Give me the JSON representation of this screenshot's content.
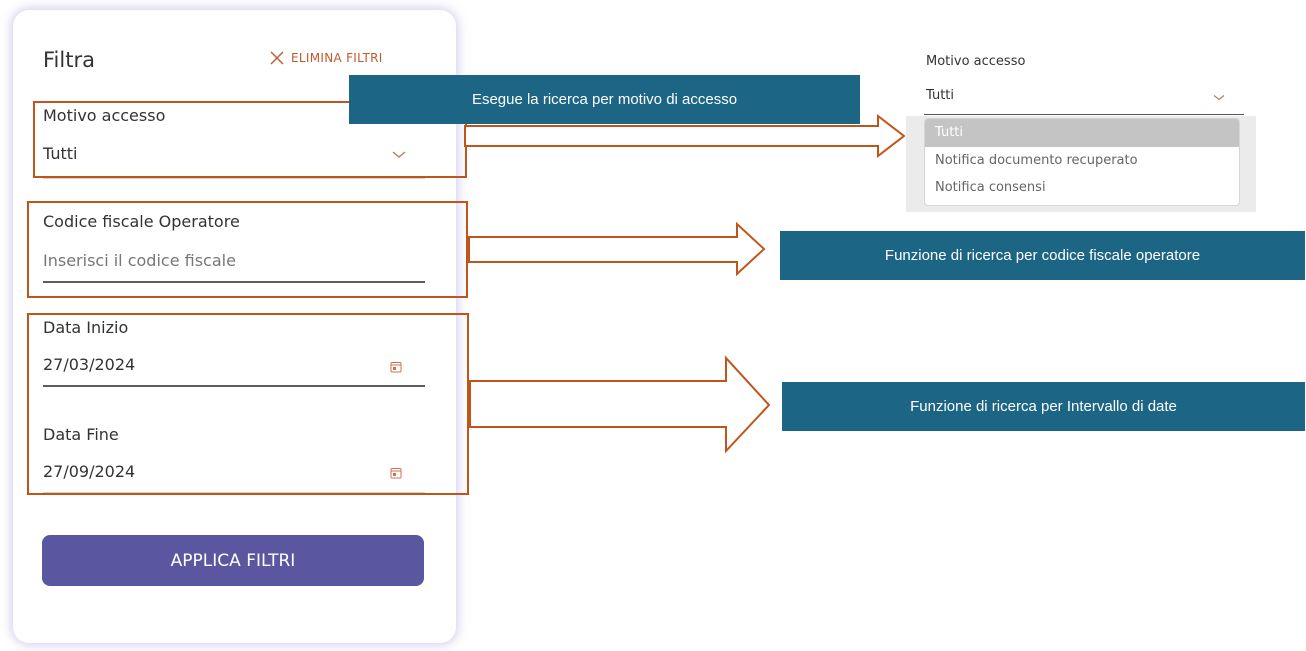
{
  "filter_panel": {
    "title": "Filtra",
    "clear_label": "ELIMINA FILTRI",
    "access_reason": {
      "label": "Motivo accesso",
      "value": "Tutti"
    },
    "fiscal_code": {
      "label": "Codice fiscale Operatore",
      "placeholder": "Inserisci il codice fiscale"
    },
    "start_date": {
      "label": "Data Inizio",
      "value": "27/03/2024"
    },
    "end_date": {
      "label": "Data Fine",
      "value": "27/09/2024"
    },
    "apply_label": "APPLICA FILTRI"
  },
  "callouts": {
    "access_reason": "Esegue la ricerca per motivo di accesso",
    "fiscal_code": "Funzione di ricerca per codice fiscale operatore",
    "date_range": "Funzione di ricerca per Intervallo di date"
  },
  "dropdown_example": {
    "label": "Motivo accesso",
    "value": "Tutti",
    "options": [
      "Tutti",
      "Notifica documento recuperato",
      "Notifica consensi"
    ],
    "selected_option": "Tutti"
  },
  "colors": {
    "highlight_border": "#c1541a",
    "callout_bg": "#1d6585",
    "apply_button_bg": "#5a57a0",
    "clear_button_text": "#c05a2c"
  },
  "icons": [
    "close-icon",
    "chevron-down-icon",
    "calendar-icon",
    "arrow-right-icon"
  ]
}
